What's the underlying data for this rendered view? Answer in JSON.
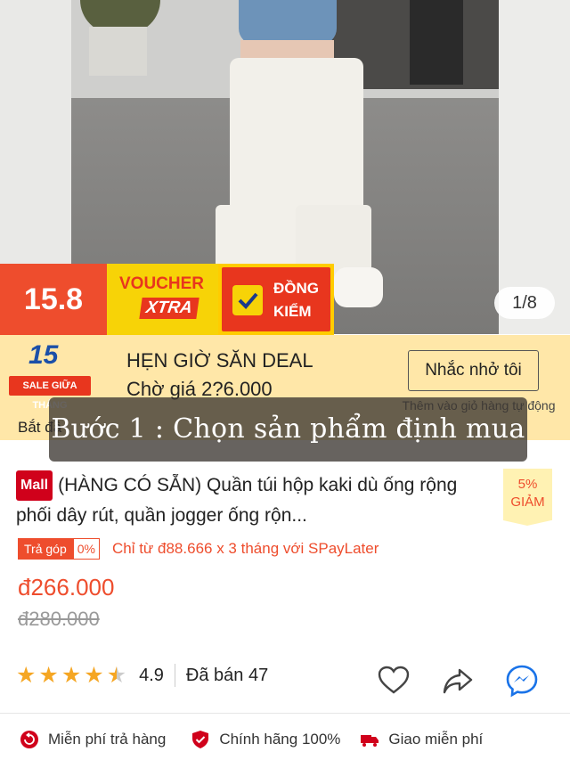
{
  "gallery": {
    "counter": "1/8"
  },
  "promo": {
    "date": "15.8",
    "voucher_line1": "VOUCHER",
    "voucher_line2": "XTRA",
    "inspect_line1": "ĐỒNG",
    "inspect_line2": "KIỂM"
  },
  "deal": {
    "logo_number": "15",
    "logo_tag": "SALE GIỮA THÁNG",
    "title": "HẸN GIỜ SĂN DEAL",
    "subtitle": "Chờ giá 2?6.000",
    "remind_button": "Nhắc nhở tôi",
    "note": "Thêm vào giỏ hàng tự động",
    "start_label": "Bắt đầ"
  },
  "overlay": {
    "caption": "Bước 1 : Chọn sản phẩm định mua"
  },
  "product": {
    "mall_badge": "Mall",
    "name": "(HÀNG CÓ SẴN) Quần túi hộp kaki dù ống rộng phối dây rút, quần jogger ống rộn...",
    "discount_percent": "5%",
    "discount_label": "GIẢM",
    "installment_tag": "Trả góp",
    "installment_rate": "0%",
    "installment_text": "Chỉ từ đ88.666 x 3 tháng với SPayLater",
    "price": "đ266.000",
    "original_price": "đ280.000",
    "rating": 4.5,
    "rating_text": "4.9",
    "sold": "Đã bán 47"
  },
  "benefits": [
    {
      "label": "Miễn phí trả hàng",
      "icon": "return-icon"
    },
    {
      "label": "Chính hãng 100%",
      "icon": "shield-check-icon"
    },
    {
      "label": "Giao miễn phí",
      "icon": "truck-icon"
    }
  ],
  "colors": {
    "accent": "#ee4d2d",
    "mall": "#d0011b",
    "deal_bg": "#ffe7a8",
    "star": "#f5a623"
  }
}
